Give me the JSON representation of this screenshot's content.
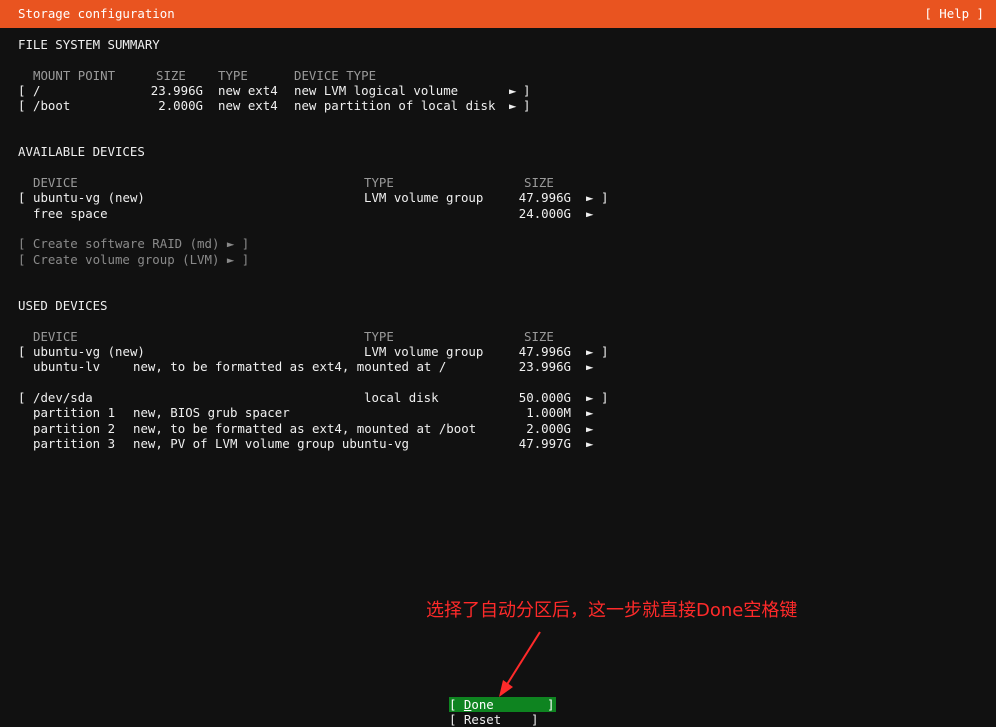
{
  "titlebar": {
    "title": "Storage configuration",
    "help": "[ Help ]"
  },
  "fs_summary": {
    "heading": "FILE SYSTEM SUMMARY",
    "headers": {
      "mount": "MOUNT POINT",
      "size": "SIZE",
      "type": "TYPE",
      "devtype": "DEVICE TYPE"
    },
    "rows": [
      {
        "bracket": "[",
        "mount": "/",
        "size": "23.996G",
        "type": "new ext4",
        "devtype": "new LVM logical volume",
        "arrow": "►",
        "close": "]"
      },
      {
        "bracket": "[",
        "mount": "/boot",
        "size": "2.000G",
        "type": "new ext4",
        "devtype": "new partition of local disk",
        "arrow": "►",
        "close": "]"
      }
    ]
  },
  "available": {
    "heading": "AVAILABLE DEVICES",
    "headers": {
      "device": "DEVICE",
      "type": "TYPE",
      "size": "SIZE"
    },
    "rows": [
      {
        "bracket": "[",
        "device": "ubuntu-vg (new)",
        "type": "LVM volume group",
        "size": "47.996G",
        "arrow": "►",
        "close": "]"
      },
      {
        "bracket": "",
        "device": "free space",
        "type": "",
        "size": "24.000G",
        "arrow": "►",
        "close": ""
      }
    ],
    "actions": [
      "[ Create software RAID (md) ► ]",
      "[ Create volume group (LVM) ► ]"
    ]
  },
  "used": {
    "heading": "USED DEVICES",
    "headers": {
      "device": "DEVICE",
      "type": "TYPE",
      "size": "SIZE"
    },
    "group1": [
      {
        "bracket": "[",
        "device": "ubuntu-vg (new)",
        "detail": "",
        "type": "LVM volume group",
        "size": "47.996G",
        "arrow": "►",
        "close": "]"
      },
      {
        "bracket": "",
        "device": "ubuntu-lv",
        "detail": "new, to be formatted as ext4, mounted at /",
        "type": "",
        "size": "23.996G",
        "arrow": "►",
        "close": ""
      }
    ],
    "group2": [
      {
        "bracket": "[",
        "device": "/dev/sda",
        "detail": "",
        "type": "local disk",
        "size": "50.000G",
        "arrow": "►",
        "close": "]"
      },
      {
        "bracket": "",
        "device": "partition 1",
        "detail": "new, BIOS grub spacer",
        "type": "",
        "size": "1.000M",
        "arrow": "►",
        "close": ""
      },
      {
        "bracket": "",
        "device": "partition 2",
        "detail": "new, to be formatted as ext4, mounted at /boot",
        "type": "",
        "size": "2.000G",
        "arrow": "►",
        "close": ""
      },
      {
        "bracket": "",
        "device": "partition 3",
        "detail": "new, PV of LVM volume group ubuntu-vg",
        "type": "",
        "size": "47.997G",
        "arrow": "►",
        "close": ""
      }
    ]
  },
  "buttons": {
    "done_open": "[ ",
    "done_key": "D",
    "done_rest": "one",
    "done_close": "]",
    "reset": "[ Reset    ]"
  },
  "annotation": {
    "text": "选择了自动分区后，这一步就直接Done空格键",
    "color": "#ff2a2a"
  },
  "colors": {
    "titlebar": "#e95420",
    "background": "#111111",
    "done_bg": "#0e8420"
  }
}
